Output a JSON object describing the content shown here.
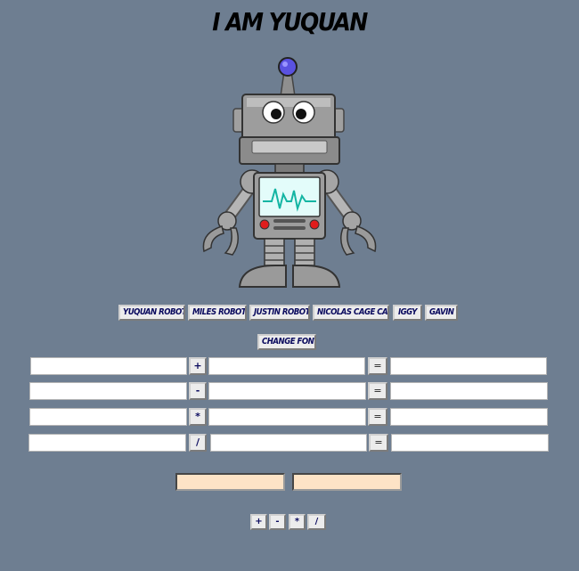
{
  "page": {
    "title": "I AM YUQUAN"
  },
  "robot_buttons": [
    "YUQUAN ROBOT",
    "MILES ROBOT",
    "JUSTIN ROBOT",
    "NICOLAS CAGE CAT",
    "IGGY",
    "GAVIN"
  ],
  "change_font_label": "CHANGE FONT",
  "calculator": {
    "rows": [
      {
        "operator": "+",
        "equals": "="
      },
      {
        "operator": "-",
        "equals": "="
      },
      {
        "operator": "*",
        "equals": "="
      },
      {
        "operator": "/",
        "equals": "="
      }
    ]
  },
  "operator_buttons": [
    "+",
    "-",
    "*",
    "/"
  ],
  "colors": {
    "background": "#6e7e91",
    "button_text": "#0a0a5e",
    "peach_input": "#fde3c6"
  }
}
